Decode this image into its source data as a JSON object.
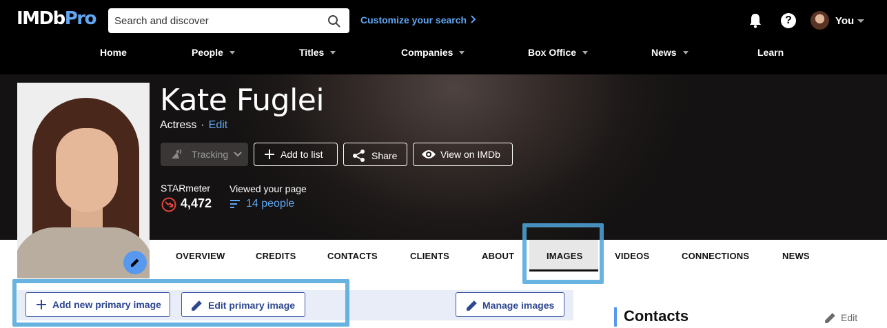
{
  "header": {
    "logo_main": "IMDb",
    "logo_pro": "Pro",
    "search_placeholder": "Search and discover",
    "customize_label": "Customize your search",
    "user_label": "You"
  },
  "nav": {
    "items": [
      {
        "label": "Home",
        "dropdown": false
      },
      {
        "label": "People",
        "dropdown": true
      },
      {
        "label": "Titles",
        "dropdown": true
      },
      {
        "label": "Companies",
        "dropdown": true
      },
      {
        "label": "Box Office",
        "dropdown": true
      },
      {
        "label": "News",
        "dropdown": true
      },
      {
        "label": "Learn",
        "dropdown": false
      }
    ]
  },
  "profile": {
    "name": "Kate Fuglei",
    "role": "Actress",
    "separator": "·",
    "edit_label": "Edit",
    "buttons": {
      "tracking": "Tracking",
      "add_to_list": "Add to list",
      "share": "Share",
      "view_on_imdb": "View on IMDb"
    },
    "starmeter_label": "STARmeter",
    "starmeter_value": "4,472",
    "viewed_label": "Viewed your page",
    "viewed_value": "14 people"
  },
  "tabs": [
    "OVERVIEW",
    "CREDITS",
    "CONTACTS",
    "CLIENTS",
    "ABOUT",
    "IMAGES",
    "VIDEOS",
    "CONNECTIONS",
    "NEWS"
  ],
  "active_tab": "IMAGES",
  "actions": {
    "add_primary": "Add new primary image",
    "edit_primary": "Edit primary image",
    "manage_images": "Manage images"
  },
  "sidebar": {
    "contacts_title": "Contacts",
    "contacts_edit": "Edit"
  },
  "colors": {
    "accent_blue": "#5799ef",
    "link_blue": "#61a6f2",
    "highlight": "#4fa6dc",
    "button_text": "#2d468f"
  }
}
